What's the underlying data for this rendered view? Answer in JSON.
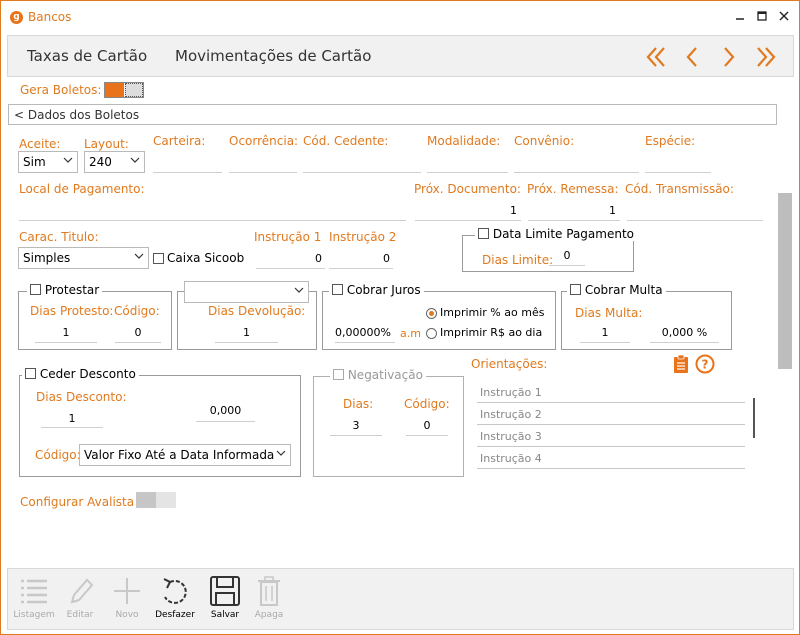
{
  "window": {
    "title": "Bancos",
    "logo_letter": "g"
  },
  "tabs": [
    {
      "label": "Taxas de Cartão"
    },
    {
      "label": "Movimentações de Cartão"
    }
  ],
  "gera_boletos": {
    "label": "Gera Boletos:"
  },
  "section": {
    "label": "< Dados dos Boletos"
  },
  "fields": {
    "aceite": {
      "label": "Aceite:",
      "value": "Sim"
    },
    "layout": {
      "label": "Layout:",
      "value": "240"
    },
    "carteira": {
      "label": "Carteira:"
    },
    "ocorrencia": {
      "label": "Ocorrência:"
    },
    "cod_cedente": {
      "label": "Cód. Cedente:"
    },
    "modalidade": {
      "label": "Modalidade:"
    },
    "convenio": {
      "label": "Convênio:"
    },
    "especie": {
      "label": "Espécie:"
    },
    "local_pagamento": {
      "label": "Local de Pagamento:"
    },
    "prox_documento": {
      "label": "Próx. Documento:",
      "value": "1"
    },
    "prox_remessa": {
      "label": "Próx. Remessa:",
      "value": "1"
    },
    "cod_transmissao": {
      "label": "Cód. Transmissão:"
    },
    "carac_titulo": {
      "label": "Carac. Titulo:",
      "value": "Simples"
    },
    "caixa_sicoob": {
      "label": "Caixa Sicoob"
    },
    "instrucao1": {
      "label": "Instrução 1",
      "value": "0"
    },
    "instrucao2": {
      "label": "Instrução 2",
      "value": "0"
    }
  },
  "data_limite": {
    "title": "Data Limite Pagamento",
    "dias_label": "Dias Limite:",
    "dias_value": "0"
  },
  "protestar": {
    "title": "Protestar",
    "dias_label": "Dias Protesto:",
    "dias_value": "1",
    "codigo_label": "Código:",
    "codigo_value": "0"
  },
  "devolucao": {
    "combo_value": "",
    "dias_label": "Dias Devolução:",
    "dias_value": "1"
  },
  "juros": {
    "title": "Cobrar Juros",
    "value": "0,00000%",
    "unit": "a.m",
    "opt1": "Imprimir % ao mês",
    "opt2": "Imprimir R$ ao dia"
  },
  "multa": {
    "title": "Cobrar Multa",
    "dias_label": "Dias Multa:",
    "dias_value": "1",
    "percent_value": "0,000 %"
  },
  "desconto": {
    "title": "Ceder Desconto",
    "dias_label": "Dias Desconto:",
    "dias_value": "1",
    "valor": "0,000",
    "codigo_label": "Código:",
    "codigo_value": "Valor Fixo Até a Data Informada"
  },
  "negativacao": {
    "title": "Negativação",
    "dias_label": "Dias:",
    "dias_value": "3",
    "codigo_label": "Código:",
    "codigo_value": "0"
  },
  "orientacoes": {
    "label": "Orientações:",
    "items": [
      "Instrução 1",
      "Instrução 2",
      "Instrução 3",
      "Instrução 4"
    ]
  },
  "avalista": {
    "label": "Configurar Avalista"
  },
  "toolbar": {
    "listagem": "Listagem",
    "editar": "Editar",
    "novo": "Novo",
    "desfazer": "Desfazer",
    "salvar": "Salvar",
    "apaga": "Apaga"
  },
  "colors": {
    "accent": "#e07a1f"
  }
}
